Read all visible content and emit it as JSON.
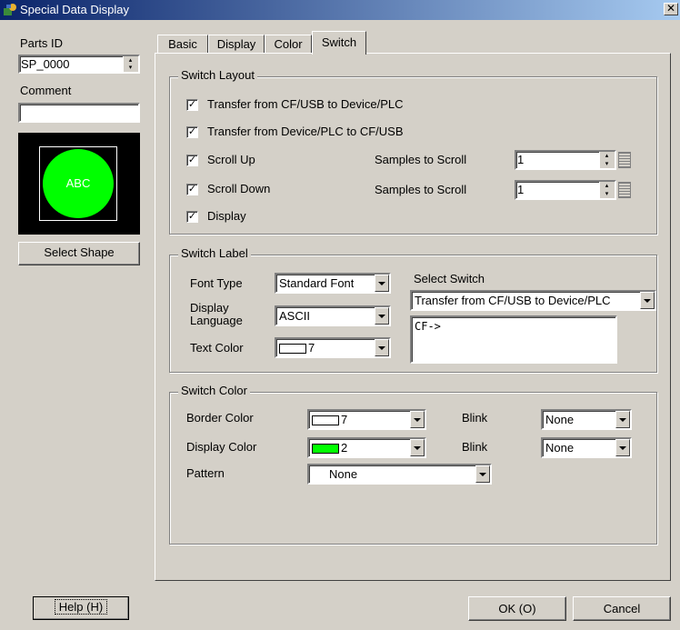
{
  "window": {
    "title": "Special Data Display",
    "close_glyph": "✕"
  },
  "left": {
    "parts_id_label": "Parts ID",
    "parts_id_value": "SP_0000",
    "comment_label": "Comment",
    "comment_value": "",
    "preview_text": "ABC",
    "preview_color": "#00ff00",
    "select_shape_label": "Select Shape"
  },
  "tabs": [
    {
      "label": "Basic",
      "active": false
    },
    {
      "label": "Display",
      "active": false
    },
    {
      "label": "Color",
      "active": false
    },
    {
      "label": "Switch",
      "active": true
    }
  ],
  "switch_layout": {
    "title": "Switch Layout",
    "items": [
      {
        "label": "Transfer from CF/USB to Device/PLC",
        "checked": true
      },
      {
        "label": "Transfer from Device/PLC to CF/USB",
        "checked": true
      },
      {
        "label": "Scroll Up",
        "checked": true
      },
      {
        "label": "Scroll Down",
        "checked": true
      },
      {
        "label": "Display",
        "checked": true
      }
    ],
    "check_glyph": "✓",
    "samples_label_up": "Samples to Scroll",
    "samples_value_up": "1",
    "samples_label_down": "Samples to Scroll",
    "samples_value_down": "1"
  },
  "switch_label": {
    "title": "Switch Label",
    "font_type_label": "Font Type",
    "font_type_value": "Standard Font",
    "display_language_label": "Display Language",
    "display_language_value": "ASCII",
    "text_color_label": "Text Color",
    "text_color_value": "7",
    "select_switch_label": "Select Switch",
    "select_switch_value": "Transfer from CF/USB to Device/PLC",
    "label_text": "CF->"
  },
  "switch_color": {
    "title": "Switch Color",
    "border_color_label": "Border Color",
    "border_color_value": "7",
    "border_color_swatch": "#ffffff",
    "blink1_label": "Blink",
    "blink1_value": "None",
    "display_color_label": "Display Color",
    "display_color_value": "2",
    "display_color_swatch": "#00ff00",
    "blink2_label": "Blink",
    "blink2_value": "None",
    "pattern_label": "Pattern",
    "pattern_value": "None"
  },
  "footer": {
    "help_label": "Help (H)",
    "ok_label": "OK (O)",
    "cancel_label": "Cancel"
  }
}
